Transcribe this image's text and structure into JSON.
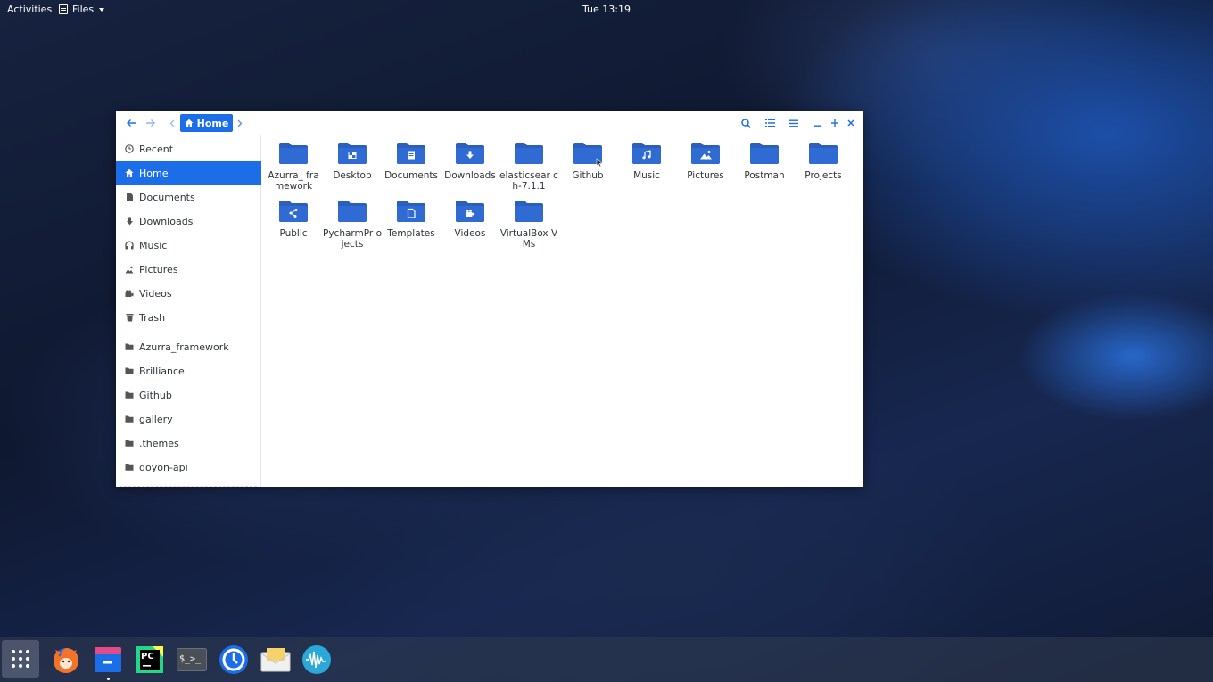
{
  "topbar": {
    "activities": "Activities",
    "app_name": "Files",
    "clock": "Tue 13:19"
  },
  "window": {
    "path_button": "Home"
  },
  "sidebar": {
    "places": [
      {
        "label": "Recent",
        "icon": "clock-icon"
      },
      {
        "label": "Home",
        "icon": "home-icon",
        "active": true
      },
      {
        "label": "Documents",
        "icon": "document-icon"
      },
      {
        "label": "Downloads",
        "icon": "download-icon"
      },
      {
        "label": "Music",
        "icon": "headphones-icon"
      },
      {
        "label": "Pictures",
        "icon": "picture-icon"
      },
      {
        "label": "Videos",
        "icon": "video-icon"
      },
      {
        "label": "Trash",
        "icon": "trash-icon"
      }
    ],
    "bookmarks": [
      {
        "label": "Azurra_framework",
        "icon": "folder-icon"
      },
      {
        "label": "Brilliance",
        "icon": "folder-icon"
      },
      {
        "label": "Github",
        "icon": "folder-icon"
      },
      {
        "label": "gallery",
        "icon": "folder-icon"
      },
      {
        "label": ".themes",
        "icon": "folder-icon"
      },
      {
        "label": "doyon-api",
        "icon": "folder-icon"
      }
    ]
  },
  "files": [
    {
      "label": "Azurra_ framework",
      "emblem": "none"
    },
    {
      "label": "Desktop",
      "emblem": "desktop"
    },
    {
      "label": "Documents",
      "emblem": "document"
    },
    {
      "label": "Downloads",
      "emblem": "download"
    },
    {
      "label": "elasticsear ch-7.1.1",
      "emblem": "none"
    },
    {
      "label": "Github",
      "emblem": "none"
    },
    {
      "label": "Music",
      "emblem": "music"
    },
    {
      "label": "Pictures",
      "emblem": "picture"
    },
    {
      "label": "Postman",
      "emblem": "none"
    },
    {
      "label": "Projects",
      "emblem": "none"
    },
    {
      "label": "Public",
      "emblem": "share"
    },
    {
      "label": "PycharmPr ojects",
      "emblem": "none"
    },
    {
      "label": "Templates",
      "emblem": "template"
    },
    {
      "label": "Videos",
      "emblem": "video"
    },
    {
      "label": "VirtualBox VMs",
      "emblem": "none"
    }
  ],
  "dock": {
    "apps": [
      "show-apps-grid-icon",
      "firefox-icon",
      "files-icon",
      "pycharm-icon",
      "terminal-icon",
      "timeshift-icon",
      "mail-icon",
      "audio-recorder-icon"
    ],
    "pycharm_badge": "PC",
    "terminal_prompt": "$_>_"
  },
  "colors": {
    "accent": "#1c6ee8",
    "folder": "#2f6bd2",
    "folder_tab": "#2a5fbe"
  }
}
